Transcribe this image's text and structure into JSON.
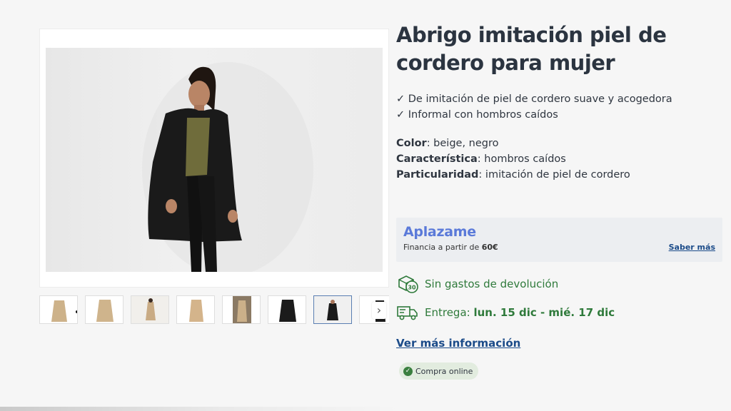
{
  "product": {
    "title": "Abrigo imitación piel de cordero para mujer",
    "bullets": [
      "✓ De imitación de piel de cordero suave y acogedora",
      "✓ Informal con hombros caídos"
    ],
    "specs": [
      {
        "label": "Color",
        "value": ": beige, negro"
      },
      {
        "label": "Característica",
        "value": ": hombros caídos"
      },
      {
        "label": "Particularidad",
        "value": ": imitación de piel de cordero"
      }
    ]
  },
  "gallery": {
    "main_image": "woman-black-faux-sheepskin-coat",
    "thumbnails": [
      {
        "image": "beige-coat",
        "active": false
      },
      {
        "image": "beige-coat",
        "active": false
      },
      {
        "image": "beige-coat-model",
        "active": false
      },
      {
        "image": "beige-coat",
        "active": false
      },
      {
        "image": "coat-model-brown",
        "active": false
      },
      {
        "image": "black-coat",
        "active": false
      },
      {
        "image": "black-coat-model",
        "active": true
      },
      {
        "image": "black-coat-partial",
        "active": false
      }
    ],
    "next_arrow": "›"
  },
  "aplazame": {
    "logo": "Aplazame",
    "text_prefix": "Financia a partir de ",
    "amount": "60€",
    "link": "Saber más"
  },
  "features": {
    "returns": "Sin gastos de devolución",
    "delivery_label": "Entrega: ",
    "delivery_dates": "lun. 15 dic - mié. 17 dic"
  },
  "more_info_link": "Ver más información",
  "badge": {
    "label": "Compra online"
  },
  "colors": {
    "title": "#2b3440",
    "green": "#2f7a3b",
    "link_blue": "#1b4b89",
    "aplazame_blue": "#5b7ad9"
  },
  "icons": [
    "return-30-icon",
    "truck-icon",
    "check-circle-icon",
    "chevron-right-icon"
  ]
}
